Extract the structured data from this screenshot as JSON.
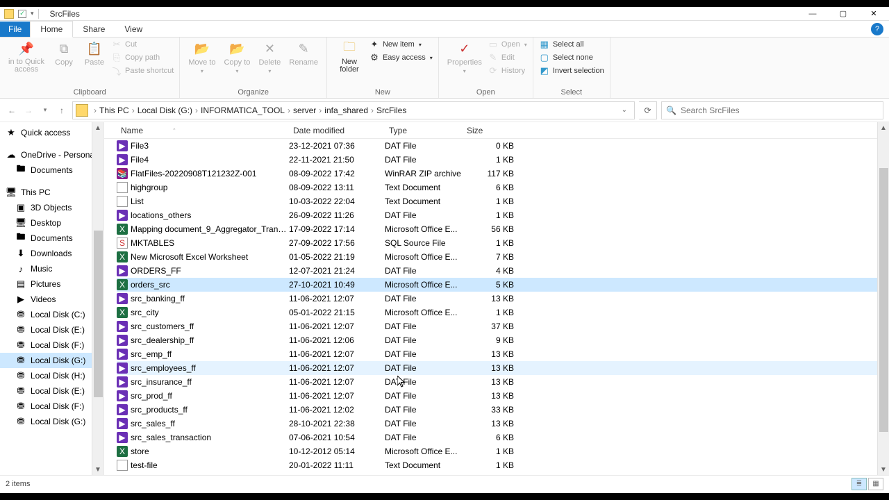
{
  "window": {
    "title": "SrcFiles"
  },
  "tabs": {
    "file": "File",
    "home": "Home",
    "share": "Share",
    "view": "View"
  },
  "ribbon": {
    "pin": "in to Quick access",
    "copy": "Copy",
    "paste": "Paste",
    "cut": "Cut",
    "copypath": "Copy path",
    "pasteshort": "Paste shortcut",
    "moveto": "Move to",
    "copyto": "Copy to",
    "delete": "Delete",
    "rename": "Rename",
    "newfolder": "New folder",
    "newitem": "New item",
    "easyaccess": "Easy access",
    "properties": "Properties",
    "open": "Open",
    "edit": "Edit",
    "history": "History",
    "selectall": "Select all",
    "selectnone": "Select none",
    "invert": "Invert selection",
    "g_clipboard": "Clipboard",
    "g_organize": "Organize",
    "g_new": "New",
    "g_open": "Open",
    "g_select": "Select"
  },
  "breadcrumbs": [
    "This PC",
    "Local Disk (G:)",
    "INFORMATICA_TOOL",
    "server",
    "infa_shared",
    "SrcFiles"
  ],
  "search": {
    "placeholder": "Search SrcFiles"
  },
  "nav": {
    "quick": "Quick access",
    "onedrive": "OneDrive - Personal",
    "documents": "Documents",
    "thispc": "This PC",
    "items": [
      "3D Objects",
      "Desktop",
      "Documents",
      "Downloads",
      "Music",
      "Pictures",
      "Videos",
      "Local Disk (C:)",
      "Local Disk (E:)",
      "Local Disk (F:)",
      "Local Disk (G:)",
      "Local Disk (H:)",
      "Local Disk (E:)",
      "Local Disk (F:)",
      "Local Disk (G:)"
    ]
  },
  "columns": {
    "name": "Name",
    "date": "Date modified",
    "type": "Type",
    "size": "Size"
  },
  "files": [
    {
      "n": "File3",
      "d": "23-12-2021 07:36",
      "t": "DAT File",
      "s": "0 KB",
      "ic": "dat"
    },
    {
      "n": "File4",
      "d": "22-11-2021 21:50",
      "t": "DAT File",
      "s": "1 KB",
      "ic": "dat"
    },
    {
      "n": "FlatFiles-20220908T121232Z-001",
      "d": "08-09-2022 17:42",
      "t": "WinRAR ZIP archive",
      "s": "117 KB",
      "ic": "zip"
    },
    {
      "n": "highgroup",
      "d": "08-09-2022 13:11",
      "t": "Text Document",
      "s": "6 KB",
      "ic": "txt"
    },
    {
      "n": "List",
      "d": "10-03-2022 22:04",
      "t": "Text Document",
      "s": "1 KB",
      "ic": "txt"
    },
    {
      "n": "locations_others",
      "d": "26-09-2022 11:26",
      "t": "DAT File",
      "s": "1 KB",
      "ic": "dat"
    },
    {
      "n": "Mapping document_9_Aggregator_Trans...",
      "d": "17-09-2022 17:14",
      "t": "Microsoft Office E...",
      "s": "56 KB",
      "ic": "xls"
    },
    {
      "n": "MKTABLES",
      "d": "27-09-2022 17:56",
      "t": "SQL Source File",
      "s": "1 KB",
      "ic": "sql"
    },
    {
      "n": "New Microsoft Excel Worksheet",
      "d": "01-05-2022 21:19",
      "t": "Microsoft Office E...",
      "s": "7 KB",
      "ic": "xls"
    },
    {
      "n": "ORDERS_FF",
      "d": "12-07-2021 21:24",
      "t": "DAT File",
      "s": "4 KB",
      "ic": "dat"
    },
    {
      "n": "orders_src",
      "d": "27-10-2021 10:49",
      "t": "Microsoft Office E...",
      "s": "5 KB",
      "ic": "xls",
      "sel": true
    },
    {
      "n": "src_banking_ff",
      "d": "11-06-2021 12:07",
      "t": "DAT File",
      "s": "13 KB",
      "ic": "dat"
    },
    {
      "n": "src_city",
      "d": "05-01-2022 21:15",
      "t": "Microsoft Office E...",
      "s": "1 KB",
      "ic": "xls"
    },
    {
      "n": "src_customers_ff",
      "d": "11-06-2021 12:07",
      "t": "DAT File",
      "s": "37 KB",
      "ic": "dat"
    },
    {
      "n": "src_dealership_ff",
      "d": "11-06-2021 12:06",
      "t": "DAT File",
      "s": "9 KB",
      "ic": "dat"
    },
    {
      "n": "src_emp_ff",
      "d": "11-06-2021 12:07",
      "t": "DAT File",
      "s": "13 KB",
      "ic": "dat"
    },
    {
      "n": "src_employees_ff",
      "d": "11-06-2021 12:07",
      "t": "DAT File",
      "s": "13 KB",
      "ic": "dat",
      "hov": true
    },
    {
      "n": "src_insurance_ff",
      "d": "11-06-2021 12:07",
      "t": "DAT File",
      "s": "13 KB",
      "ic": "dat"
    },
    {
      "n": "src_prod_ff",
      "d": "11-06-2021 12:07",
      "t": "DAT File",
      "s": "13 KB",
      "ic": "dat"
    },
    {
      "n": "src_products_ff",
      "d": "11-06-2021 12:02",
      "t": "DAT File",
      "s": "33 KB",
      "ic": "dat"
    },
    {
      "n": "src_sales_ff",
      "d": "28-10-2021 22:38",
      "t": "DAT File",
      "s": "13 KB",
      "ic": "dat"
    },
    {
      "n": "src_sales_transaction",
      "d": "07-06-2021 10:54",
      "t": "DAT File",
      "s": "6 KB",
      "ic": "dat"
    },
    {
      "n": "store",
      "d": "10-12-2012 05:14",
      "t": "Microsoft Office E...",
      "s": "1 KB",
      "ic": "xls"
    },
    {
      "n": "test-file",
      "d": "20-01-2022 11:11",
      "t": "Text Document",
      "s": "1 KB",
      "ic": "txt"
    }
  ],
  "status": {
    "text": "2 items"
  }
}
